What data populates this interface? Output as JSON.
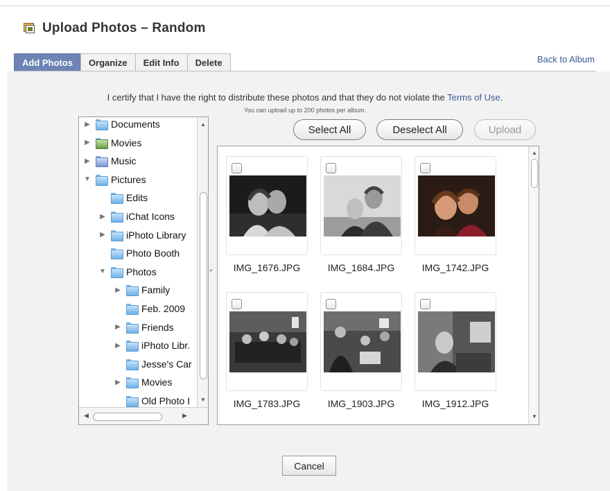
{
  "header": {
    "title": "Upload Photos – Random",
    "icon": "photo-album-icon"
  },
  "tabs": [
    {
      "label": "Add Photos",
      "active": true
    },
    {
      "label": "Organize"
    },
    {
      "label": "Edit Info"
    },
    {
      "label": "Delete"
    }
  ],
  "back_link": "Back to Album",
  "notice": {
    "certify_before": "I certify that I have the right to distribute these photos and that they do not violate the ",
    "terms_link": "Terms of Use",
    "certify_after": ".",
    "limit": "You can upload up to 200 photos per album."
  },
  "tree": {
    "items": [
      {
        "label": "Documents",
        "expand": "collapsed",
        "icon": "documents-folder-icon"
      },
      {
        "label": "Movies",
        "expand": "collapsed",
        "icon": "movies-folder-icon"
      },
      {
        "label": "Music",
        "expand": "collapsed",
        "icon": "music-folder-icon"
      },
      {
        "label": "Pictures",
        "expand": "expanded",
        "icon": "pictures-folder-icon"
      },
      {
        "label": "Edits",
        "expand": "none",
        "icon": "folder-icon"
      },
      {
        "label": "iChat Icons",
        "expand": "collapsed",
        "icon": "folder-icon"
      },
      {
        "label": "iPhoto Library",
        "expand": "collapsed",
        "icon": "folder-icon"
      },
      {
        "label": "Photo Booth",
        "expand": "none",
        "icon": "folder-icon"
      },
      {
        "label": "Photos",
        "expand": "expanded",
        "icon": "folder-icon"
      },
      {
        "label": "Family",
        "expand": "collapsed",
        "icon": "folder-icon"
      },
      {
        "label": "Feb. 2009",
        "expand": "none",
        "icon": "folder-icon"
      },
      {
        "label": "Friends",
        "expand": "collapsed",
        "icon": "folder-icon"
      },
      {
        "label": "iPhoto Libr.",
        "expand": "collapsed",
        "icon": "folder-icon"
      },
      {
        "label": "Jesse's Car",
        "expand": "none",
        "icon": "folder-icon"
      },
      {
        "label": "Movies",
        "expand": "collapsed",
        "icon": "folder-icon"
      },
      {
        "label": "Old Photo I",
        "expand": "none",
        "icon": "folder-icon"
      }
    ]
  },
  "buttons": {
    "select_all": "Select All",
    "deselect_all": "Deselect All",
    "upload": "Upload",
    "cancel": "Cancel"
  },
  "photos": [
    {
      "filename": "IMG_1676.JPG",
      "checked": false
    },
    {
      "filename": "IMG_1684.JPG",
      "checked": false
    },
    {
      "filename": "IMG_1742.JPG",
      "checked": false
    },
    {
      "filename": "IMG_1783.JPG",
      "checked": false
    },
    {
      "filename": "IMG_1903.JPG",
      "checked": false
    },
    {
      "filename": "IMG_1912.JPG",
      "checked": false
    }
  ],
  "colors": {
    "active_tab": "#6d84b4",
    "link": "#3b5998",
    "panel_bg": "#f2f2f2"
  }
}
